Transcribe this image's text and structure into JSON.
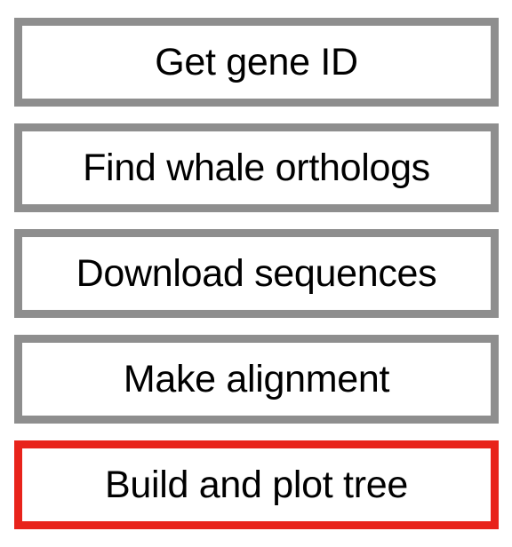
{
  "steps": [
    {
      "label": "Get gene ID",
      "status": "done"
    },
    {
      "label": "Find whale orthologs",
      "status": "done"
    },
    {
      "label": "Download sequences",
      "status": "done"
    },
    {
      "label": "Make alignment",
      "status": "done"
    },
    {
      "label": "Build and plot tree",
      "status": "current"
    }
  ],
  "colors": {
    "default_border": "#8e8e8e",
    "active_border": "#e8231b",
    "text": "#000000",
    "background": "#ffffff"
  }
}
